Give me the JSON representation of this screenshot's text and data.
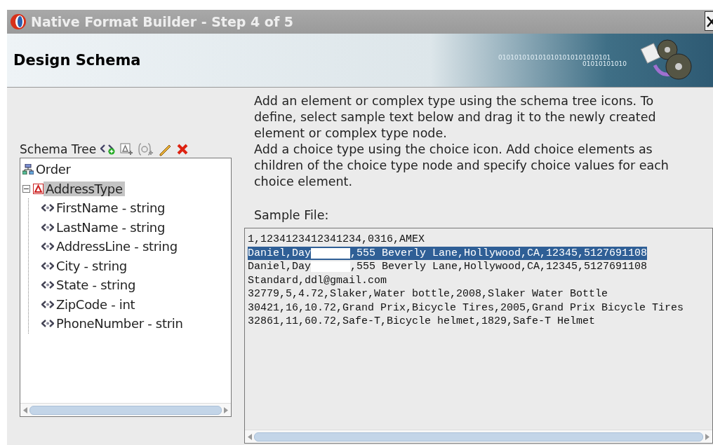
{
  "window": {
    "title": "Native Format Builder - Step 4 of 5"
  },
  "header": {
    "title": "Design Schema",
    "banner_text": [
      "0101010101010101010101010101",
      "01010101010"
    ]
  },
  "schema_tree": {
    "label": "Schema Tree",
    "nodes": [
      {
        "label": "Order",
        "kind": "root",
        "selected": false
      },
      {
        "label": "AddressType",
        "kind": "complex",
        "selected": true,
        "expanded": true,
        "children": [
          {
            "label": "FirstName - string",
            "kind": "element",
            "selected": false
          },
          {
            "label": "LastName - string",
            "kind": "element",
            "selected": false
          },
          {
            "label": "AddressLine - string",
            "kind": "element",
            "selected": false
          },
          {
            "label": "City - string",
            "kind": "element",
            "selected": false
          },
          {
            "label": "State - string",
            "kind": "element",
            "selected": false
          },
          {
            "label": "ZipCode - int",
            "kind": "element",
            "selected": false
          },
          {
            "label": "PhoneNumber - strin",
            "kind": "element",
            "selected": false
          }
        ]
      }
    ]
  },
  "instructions": [
    "Add an element or complex type using the schema tree icons. To define, select sample text below and drag it to the newly created element or complex type node.",
    "Add a choice type using the choice icon. Add choice elements as children of the choice type node and specify choice values for each choice element."
  ],
  "sample_file": {
    "label": "Sample File:",
    "lines": [
      {
        "segments": [
          "1,1234123412341234,0316,AMEX"
        ],
        "selected": false
      },
      {
        "segments": [
          "Daniel,Day",
          ",555 Beverly Lane,Hollywood,CA,12345,5127691108"
        ],
        "selected": true
      },
      {
        "segments": [
          "Daniel,Day",
          ",555 Beverly Lane,Hollywood,CA,12345,5127691108"
        ],
        "selected": false
      },
      {
        "segments": [
          "Standard,ddl@gmail.com"
        ],
        "selected": false
      },
      {
        "segments": [
          "32779,5,4.72,Slaker,Water bottle,2008,Slaker Water Bottle"
        ],
        "selected": false
      },
      {
        "segments": [
          "30421,16,10.72,Grand Prix,Bicycle Tires,2005,Grand Prix Bicycle Tires"
        ],
        "selected": false
      },
      {
        "segments": [
          "32861,11,60.72,Safe-T,Bicycle helmet,1829,Safe-T Helmet"
        ],
        "selected": false
      }
    ]
  }
}
